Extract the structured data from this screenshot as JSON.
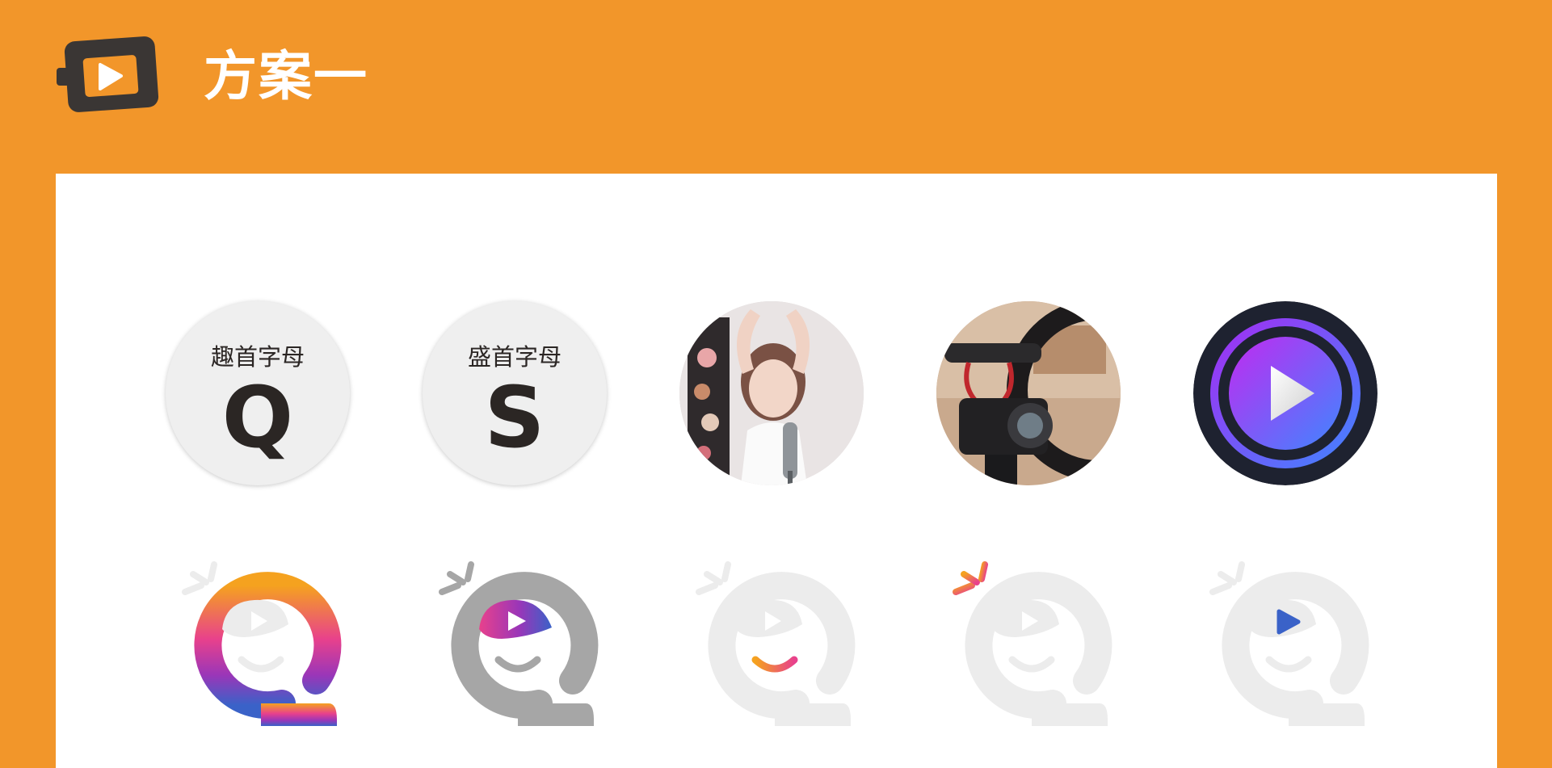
{
  "header": {
    "title": "方案一",
    "logo_icon": "video-play-icon"
  },
  "colors": {
    "background": "#F2962A",
    "panel": "#FFFFFF",
    "logo_dark": "#3a3634",
    "text_dark": "#2b2624",
    "placeholder_gray": "#ececec",
    "mid_gray": "#a6a6a6",
    "gradient_orange": "#F5A21F",
    "gradient_pink": "#E8418C",
    "gradient_purple": "#7E35C4",
    "gradient_blue": "#3A62C8",
    "play_purple": "#B02FF2",
    "play_blue": "#4A7BFF",
    "play_dark": "#1e2230"
  },
  "avatars": [
    {
      "kind": "letter",
      "caption": "趣首字母",
      "letter": "Q"
    },
    {
      "kind": "letter",
      "caption": "盛首字母",
      "letter": "S"
    },
    {
      "kind": "photo",
      "subject": "streamer-portrait"
    },
    {
      "kind": "photo",
      "subject": "camera-with-ring-light"
    },
    {
      "kind": "icon",
      "icon": "play-button-icon"
    }
  ],
  "logo_variants": [
    {
      "name": "full-gradient"
    },
    {
      "name": "gray-with-gradient-play"
    },
    {
      "name": "light-with-gradient-smile"
    },
    {
      "name": "light-with-gradient-sparks"
    },
    {
      "name": "light-with-blue-play"
    }
  ]
}
